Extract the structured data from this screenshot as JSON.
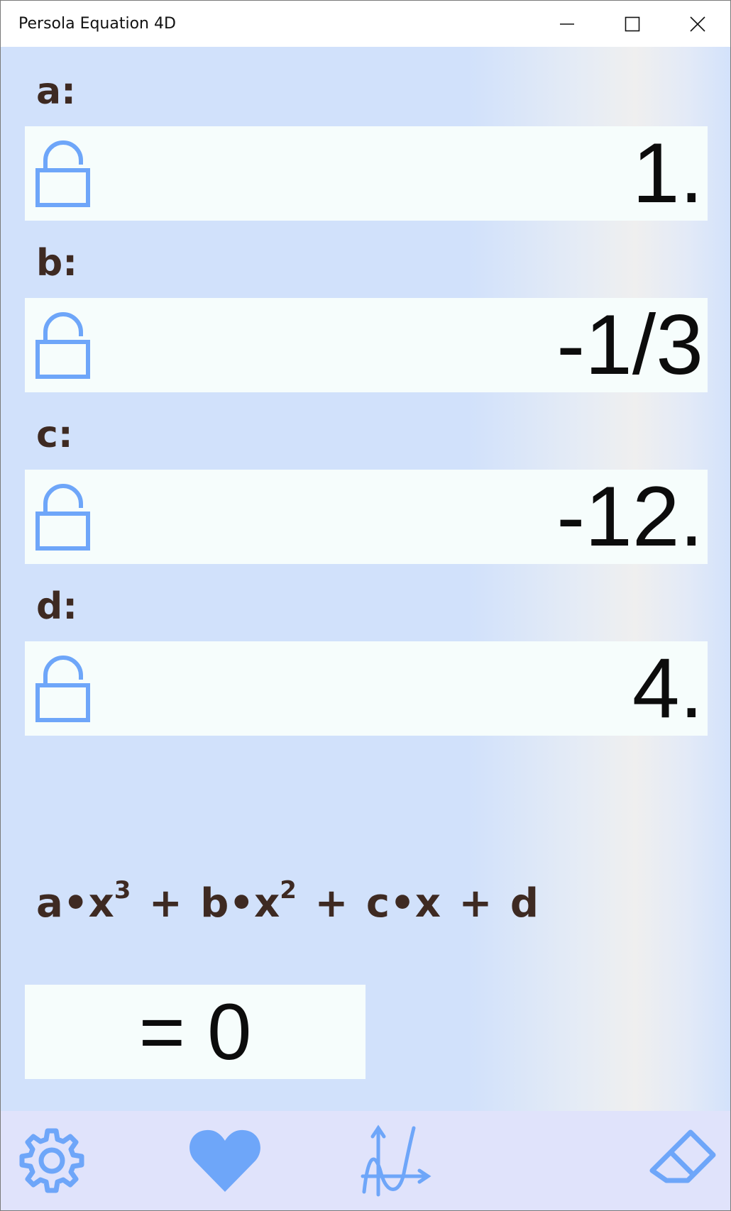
{
  "window": {
    "title": "Persola Equation 4D"
  },
  "colors": {
    "accent": "#6ea6f9",
    "background": "#d1e1fb",
    "field": "#f6fdfc",
    "label": "#3e2a22",
    "toolbar": "#e0e3fb"
  },
  "params": [
    {
      "label": "a:",
      "value": "1.",
      "icon": "unlocked-lock-icon"
    },
    {
      "label": "b:",
      "value": "-1/3",
      "icon": "unlocked-lock-icon"
    },
    {
      "label": "c:",
      "value": "-12.",
      "icon": "unlocked-lock-icon"
    },
    {
      "label": "d:",
      "value": "4.",
      "icon": "unlocked-lock-icon"
    }
  ],
  "equation": {
    "a": "a•x",
    "exp3": "3",
    "plus1": "+",
    "b": "b•x",
    "exp2": "2",
    "plus2": "+",
    "c": "c•x",
    "plus3": "+",
    "d": "d",
    "result": "= 0"
  },
  "toolbar": {
    "icons": [
      "gear-icon",
      "heart-icon",
      "graph-icon",
      "eraser-icon"
    ]
  }
}
